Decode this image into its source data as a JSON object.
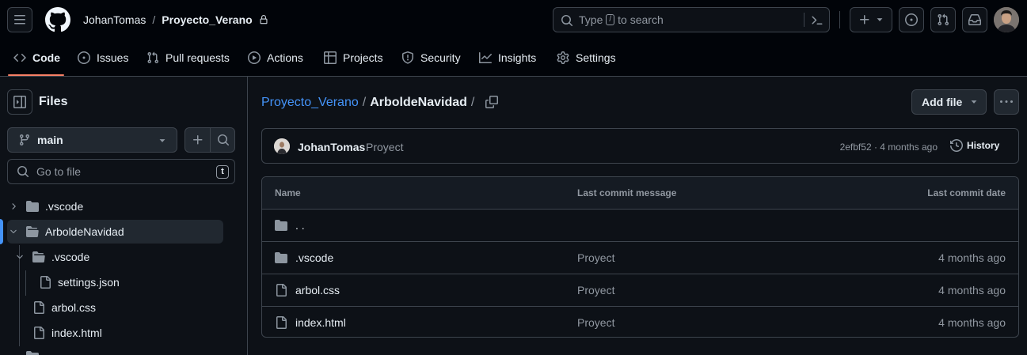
{
  "header": {
    "owner": "JohanTomas",
    "separator": "/",
    "repo": "Proyecto_Verano",
    "search_placeholder_prefix": "Type",
    "search_key": "/",
    "search_placeholder_suffix": "to search"
  },
  "repo_nav": [
    {
      "label": "Code",
      "icon": "code-icon"
    },
    {
      "label": "Issues",
      "icon": "issue-icon"
    },
    {
      "label": "Pull requests",
      "icon": "pull-request-icon"
    },
    {
      "label": "Actions",
      "icon": "play-icon"
    },
    {
      "label": "Projects",
      "icon": "table-icon"
    },
    {
      "label": "Security",
      "icon": "shield-icon"
    },
    {
      "label": "Insights",
      "icon": "graph-icon"
    },
    {
      "label": "Settings",
      "icon": "gear-icon"
    }
  ],
  "sidebar": {
    "title": "Files",
    "branch": "main",
    "go_to_file": "Go to file",
    "go_to_file_key": "t",
    "tree": [
      {
        "label": ".vscode",
        "type": "folder",
        "expanded": false,
        "depth": 0
      },
      {
        "label": "ArboldeNavidad",
        "type": "folder",
        "expanded": true,
        "depth": 0,
        "selected": true
      },
      {
        "label": ".vscode",
        "type": "folder",
        "expanded": true,
        "depth": 1
      },
      {
        "label": "settings.json",
        "type": "file",
        "depth": 2
      },
      {
        "label": "arbol.css",
        "type": "file",
        "depth": 1
      },
      {
        "label": "index.html",
        "type": "file",
        "depth": 1
      }
    ]
  },
  "breadcrumb": {
    "repo": "Proyecto_Verano",
    "sep1": "/",
    "folder": "ArboldeNavidad",
    "sep2": "/"
  },
  "add_file_label": "Add file",
  "commit": {
    "author": "JohanTomas",
    "message": "Proyect",
    "hash_time": "2efbf52 · 4 months ago",
    "history_label": "History"
  },
  "table": {
    "headers": {
      "name": "Name",
      "message": "Last commit message",
      "date": "Last commit date"
    },
    "parent_label": ". .",
    "rows": [
      {
        "name": ".vscode",
        "type": "folder",
        "message": "Proyect",
        "date": "4 months ago"
      },
      {
        "name": "arbol.css",
        "type": "file",
        "message": "Proyect",
        "date": "4 months ago"
      },
      {
        "name": "index.html",
        "type": "file",
        "message": "Proyect",
        "date": "4 months ago"
      }
    ]
  },
  "colors": {
    "background": "#0d1117",
    "header_bg": "#010409",
    "border": "#3d444d",
    "link": "#4493f8",
    "accent_underline": "#f78166",
    "muted": "#9198a1"
  }
}
